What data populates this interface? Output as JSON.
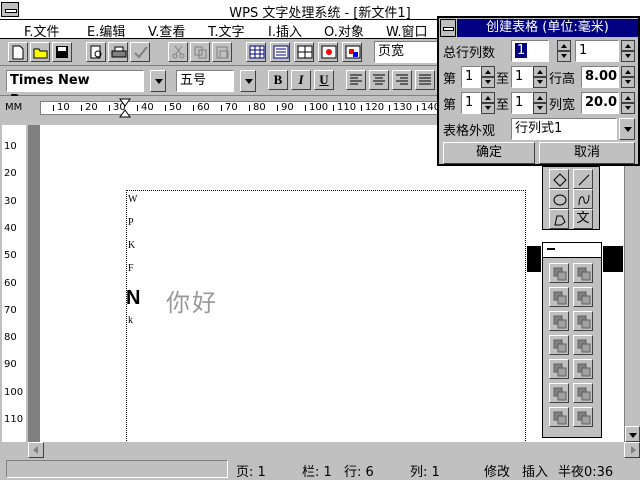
{
  "window": {
    "title": "WPS 文字处理系统 - [新文件1]"
  },
  "menu": [
    {
      "label": "F.文件"
    },
    {
      "label": "E.编辑"
    },
    {
      "label": "V.查看"
    },
    {
      "label": "T.文字"
    },
    {
      "label": "I.插入"
    },
    {
      "label": "O.对象"
    },
    {
      "label": "W.窗口"
    }
  ],
  "toolbar": {
    "view_select": "页宽"
  },
  "format_bar": {
    "font_name": "Times New Roman",
    "font_size": "五号",
    "bold": "B",
    "italic": "I",
    "underline": "U"
  },
  "ruler": {
    "unit": "MM",
    "h_ticks": [
      "10",
      "20",
      "30",
      "40",
      "50",
      "60",
      "70",
      "80",
      "90",
      "100",
      "110",
      "120",
      "130",
      "140"
    ],
    "v_ticks": [
      "10",
      "20",
      "30",
      "40",
      "50",
      "60",
      "70",
      "80",
      "90",
      "100",
      "110"
    ]
  },
  "document": {
    "vertical_letters": [
      "W",
      "P",
      "K",
      "F"
    ],
    "big_letter": "N",
    "cjk_text": "你好",
    "small_letter": "k"
  },
  "dialog": {
    "title": "创建表格 (单位:毫米)",
    "total_cols_label": "总行列数",
    "total_cols_value": "1",
    "total_rows_value": "1",
    "row_from_label": "第",
    "row_from_value": "1",
    "row_to_label": "至",
    "row_to_value": "1",
    "row_height_label": "行高",
    "row_height_value": "8.00",
    "col_from_label": "第",
    "col_from_value": "1",
    "col_to_label": "至",
    "col_to_value": "1",
    "col_width_label": "列宽",
    "col_width_value": "20.0",
    "appearance_label": "表格外观",
    "appearance_value": "行列式1",
    "ok_label": "确定",
    "cancel_label": "取消"
  },
  "draw_palette": {
    "text_tool_label": "文"
  },
  "status": {
    "page": "页: 1",
    "column": "栏: 1",
    "row": "行: 6",
    "col": "列: 1",
    "mode": "修改",
    "insert": "插入",
    "time": "半夜0:36"
  }
}
